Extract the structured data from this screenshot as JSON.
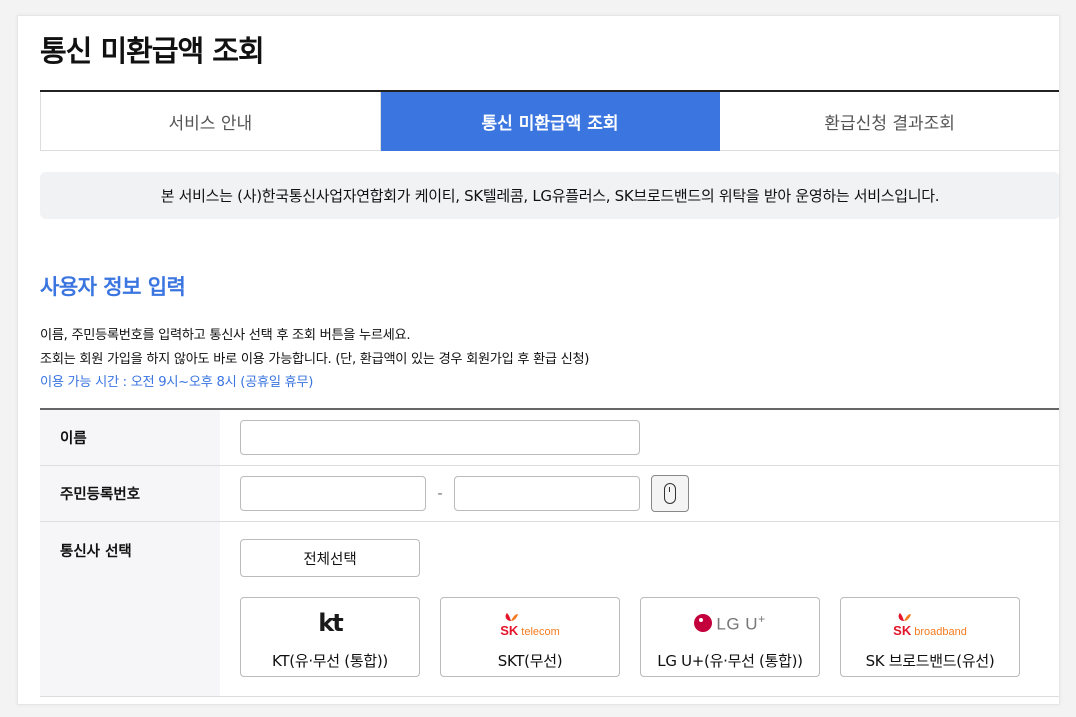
{
  "page": {
    "title": "통신 미환급액 조회"
  },
  "tabs": [
    {
      "label": "서비스 안내",
      "active": false
    },
    {
      "label": "통신 미환급액 조회",
      "active": true
    },
    {
      "label": "환급신청 결과조회",
      "active": false
    }
  ],
  "notice": "본 서비스는 (사)한국통신사업자연합회가 케이티, SK텔레콤, LG유플러스, SK브로드밴드의 위탁을 받아 운영하는 서비스입니다.",
  "section": {
    "title": "사용자 정보 입력",
    "desc1": "이름, 주민등록번호를 입력하고 통신사 선택 후 조회 버튼을 누르세요.",
    "desc2": "조회는 회원 가입을 하지 않아도 바로 이용 가능합니다. (단, 환급액이 있는 경우 회원가입 후 환급 신청)",
    "hours": "이용 가능 시간 : 오전 9시~오후 8시 (공휴일 휴무)"
  },
  "form": {
    "name_label": "이름",
    "name_value": "",
    "rrn_label": "주민등록번호",
    "rrn_front_value": "",
    "rrn_back_value": "",
    "rrn_separator": "-",
    "keypad_icon": "mouse-icon",
    "carrier_label": "통신사 선택",
    "select_all_label": "전체선택"
  },
  "carriers": [
    {
      "name": "KT(유·무선 (통합))",
      "logo": "kt"
    },
    {
      "name": "SKT(무선)",
      "logo_main": "SK",
      "logo_sub": "telecom"
    },
    {
      "name": "LG U+(유·무선 (통합))",
      "logo_text": "LG U",
      "logo_plus": "+"
    },
    {
      "name": "SK 브로드밴드(유선)",
      "logo_main": "SK",
      "logo_sub": "broadband"
    }
  ],
  "colors": {
    "accent": "#3a75e0",
    "sk_red": "#e4142b",
    "sk_orange": "#f47b20",
    "lg_magenta": "#c3003b"
  }
}
